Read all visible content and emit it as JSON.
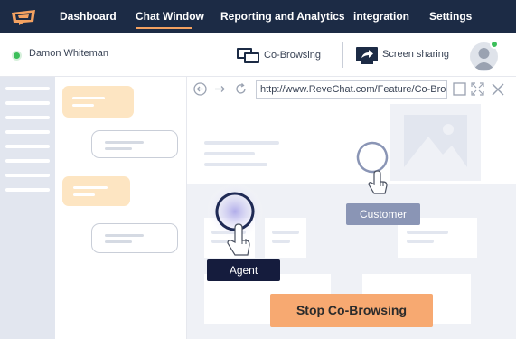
{
  "nav": {
    "items": [
      "Dashboard",
      "Chat Window",
      "Reporting and Analytics",
      "integration",
      "Settings"
    ],
    "active": "Chat Window",
    "accent": "#f4a261"
  },
  "toolbar": {
    "agent_name": "Damon Whiteman",
    "cobrowse_label": "Co-Browsing",
    "share_label": "Screen sharing"
  },
  "browser": {
    "url": "http://www.ReveChat.com/Feature/Co-Bro"
  },
  "cursors": {
    "customer_label": "Customer",
    "agent_label": "Agent"
  },
  "actions": {
    "stop_label": "Stop Co-Browsing"
  },
  "colors": {
    "nav_bg": "#1c2b45",
    "stop_button": "#f7a971",
    "customer_tag": "#8a95b5",
    "agent_tag": "#151c3d",
    "online": "#3cbf5a"
  },
  "icons": [
    "logo-icon",
    "cobrowse-icon",
    "screen-share-icon",
    "avatar-icon",
    "back-icon",
    "forward-icon",
    "refresh-icon",
    "maximize-icon",
    "fullscreen-icon",
    "close-icon",
    "image-placeholder-icon",
    "hand-pointer-icon"
  ]
}
